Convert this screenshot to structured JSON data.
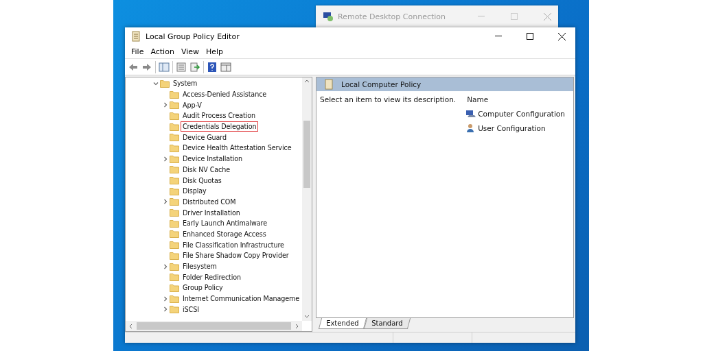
{
  "background_window": {
    "title": "Remote Desktop Connection"
  },
  "window": {
    "title": "Local Group Policy Editor",
    "menu": [
      "File",
      "Action",
      "View",
      "Help"
    ],
    "tree": {
      "label": "System",
      "expanded": true,
      "children": [
        {
          "label": "Access-Denied Assistance",
          "expandable": false,
          "highlighted": false
        },
        {
          "label": "App-V",
          "expandable": true,
          "highlighted": false
        },
        {
          "label": "Audit Process Creation",
          "expandable": false,
          "highlighted": false
        },
        {
          "label": "Credentials Delegation",
          "expandable": false,
          "highlighted": true
        },
        {
          "label": "Device Guard",
          "expandable": false,
          "highlighted": false
        },
        {
          "label": "Device Health Attestation Service",
          "expandable": false,
          "highlighted": false
        },
        {
          "label": "Device Installation",
          "expandable": true,
          "highlighted": false
        },
        {
          "label": "Disk NV Cache",
          "expandable": false,
          "highlighted": false
        },
        {
          "label": "Disk Quotas",
          "expandable": false,
          "highlighted": false
        },
        {
          "label": "Display",
          "expandable": false,
          "highlighted": false
        },
        {
          "label": "Distributed COM",
          "expandable": true,
          "highlighted": false
        },
        {
          "label": "Driver Installation",
          "expandable": false,
          "highlighted": false
        },
        {
          "label": "Early Launch Antimalware",
          "expandable": false,
          "highlighted": false
        },
        {
          "label": "Enhanced Storage Access",
          "expandable": false,
          "highlighted": false
        },
        {
          "label": "File Classification Infrastructure",
          "expandable": false,
          "highlighted": false
        },
        {
          "label": "File Share Shadow Copy Provider",
          "expandable": false,
          "highlighted": false
        },
        {
          "label": "Filesystem",
          "expandable": true,
          "highlighted": false
        },
        {
          "label": "Folder Redirection",
          "expandable": false,
          "highlighted": false
        },
        {
          "label": "Group Policy",
          "expandable": false,
          "highlighted": false
        },
        {
          "label": "Internet Communication Manageme",
          "expandable": true,
          "highlighted": false
        },
        {
          "label": "iSCSI",
          "expandable": true,
          "highlighted": false
        }
      ]
    },
    "details": {
      "header": "Local Computer Policy",
      "description": "Select an item to view its description.",
      "column": "Name",
      "items": [
        {
          "label": "Computer Configuration",
          "kind": "computer"
        },
        {
          "label": "User Configuration",
          "kind": "user"
        }
      ]
    },
    "tabs": [
      {
        "label": "Extended",
        "selected": true
      },
      {
        "label": "Standard",
        "selected": false
      }
    ]
  }
}
